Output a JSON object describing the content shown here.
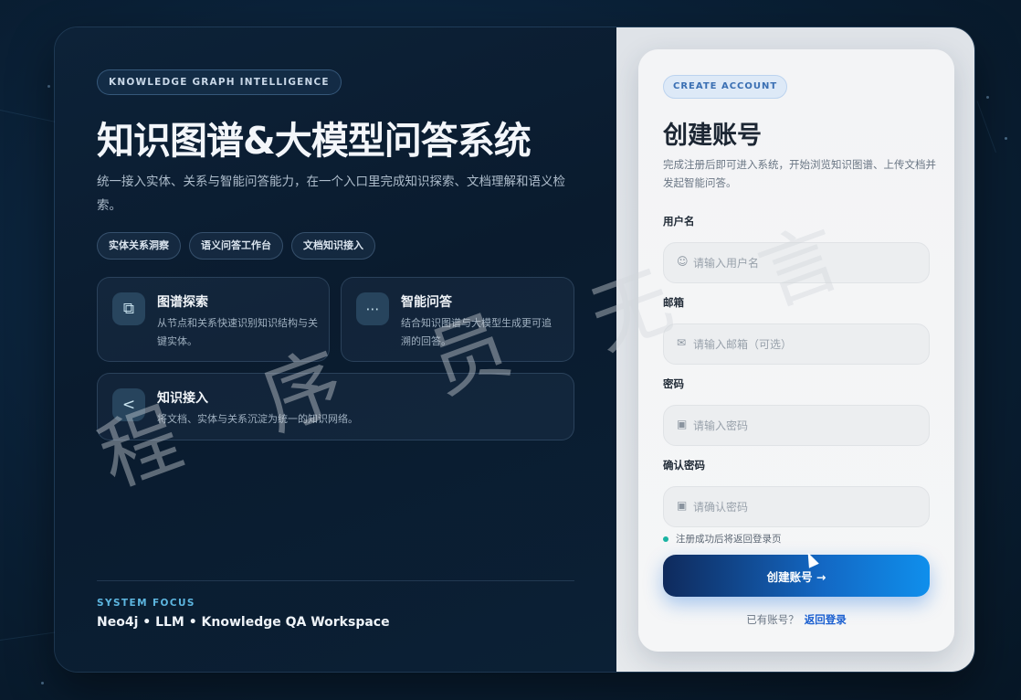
{
  "left": {
    "badge": "KNOWLEDGE GRAPH INTELLIGENCE",
    "title": "知识图谱&大模型问答系统",
    "description": "统一接入实体、关系与智能问答能力，在一个入口里完成知识探索、文档理解和语义检索。",
    "tags": [
      "实体关系洞察",
      "语义问答工作台",
      "文档知识接入"
    ],
    "features": [
      {
        "icon": "graph-link-icon",
        "glyph": "⧉",
        "title": "图谱探索",
        "desc": "从节点和关系快速识别知识结构与关键实体。"
      },
      {
        "icon": "chat-bubble-icon",
        "glyph": "💬",
        "title": "智能问答",
        "desc": "结合知识图谱与大模型生成更可追溯的回答。"
      },
      {
        "icon": "share-nodes-icon",
        "glyph": "⋖",
        "title": "知识接入",
        "desc": "将文档、实体与关系沉淀为统一的知识网络。"
      }
    ],
    "focus_label": "SYSTEM FOCUS",
    "focus_value": "Neo4j • LLM • Knowledge QA Workspace"
  },
  "form": {
    "badge": "CREATE ACCOUNT",
    "title": "创建账号",
    "subtitle": "完成注册后即可进入系统，开始浏览知识图谱、上传文档并发起智能问答。",
    "username": {
      "label": "用户名",
      "placeholder": "请输入用户名",
      "icon": "user-icon"
    },
    "email": {
      "label": "邮箱",
      "placeholder": "请输入邮箱（可选）",
      "icon": "mail-icon"
    },
    "password": {
      "label": "密码",
      "placeholder": "请输入密码",
      "icon": "lock-icon"
    },
    "confirm": {
      "label": "确认密码",
      "placeholder": "请确认密码",
      "icon": "lock-icon"
    },
    "hint": "注册成功后将返回登录页",
    "submit": "创建账号 →",
    "login_question": "已有账号？",
    "login_link": "返回登录"
  },
  "watermark": [
    "程",
    "序",
    "员",
    "无",
    "言"
  ]
}
